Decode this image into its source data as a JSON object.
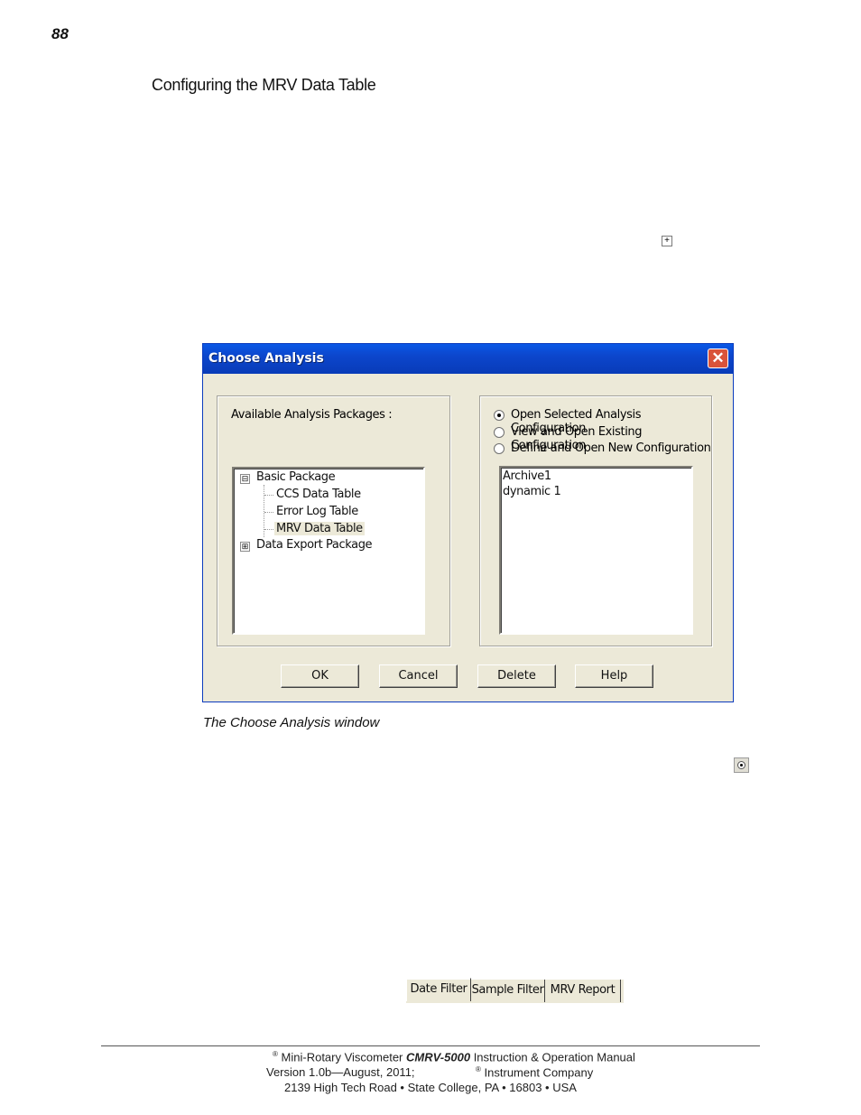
{
  "page": {
    "number": "88",
    "section_title": "Configuring the MRV Data Table",
    "caption": "The Choose Analysis window"
  },
  "dialog": {
    "title": "Choose Analysis",
    "left_group_label": "Available Analysis Packages :",
    "tree": [
      {
        "label": "Basic Package",
        "expander": "⊟"
      },
      {
        "label": "CCS Data Table"
      },
      {
        "label": "Error Log Table"
      },
      {
        "label": "MRV Data Table",
        "selected": true
      },
      {
        "label": "Data Export Package",
        "expander": "⊞"
      }
    ],
    "radio_options": [
      {
        "label": "Open Selected Analysis Configuration",
        "checked": true
      },
      {
        "label": "View and Open Existing Configuration",
        "checked": false
      },
      {
        "label": "Define and Open New Configuration",
        "checked": false
      }
    ],
    "configurations": [
      "Archive1",
      "dynamic 1"
    ],
    "buttons": {
      "ok": "OK",
      "cancel": "Cancel",
      "delete": "Delete",
      "help": "Help"
    }
  },
  "tabs": [
    "Date Filter",
    "Sample Filter",
    "MRV Report"
  ],
  "footer": {
    "sup": "®",
    "line1_pre": "Mini-Rotary Viscometer",
    "line1_model": "CMRV-5000",
    "line1_post": "Instruction & Operation Manual",
    "line2_a": "Version 1.0b—August, 2011;",
    "line2_b": "Instrument Company",
    "line3": "2139 High Tech Road • State College, PA • 16803 • USA"
  }
}
